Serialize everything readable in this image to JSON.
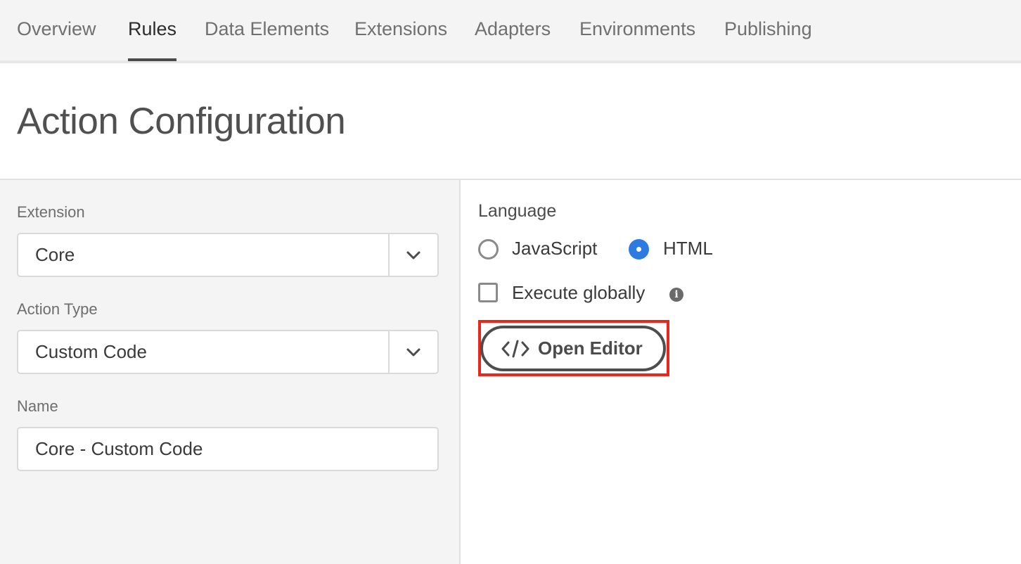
{
  "nav": {
    "tabs": [
      {
        "label": "Overview"
      },
      {
        "label": "Rules"
      },
      {
        "label": "Data Elements"
      },
      {
        "label": "Extensions"
      },
      {
        "label": "Adapters"
      },
      {
        "label": "Environments"
      },
      {
        "label": "Publishing"
      }
    ],
    "active_tab": "Rules"
  },
  "header": {
    "title": "Action Configuration"
  },
  "form": {
    "extension": {
      "label": "Extension",
      "value": "Core"
    },
    "action_type": {
      "label": "Action Type",
      "value": "Custom Code"
    },
    "name": {
      "label": "Name",
      "value": "Core - Custom Code"
    }
  },
  "settings": {
    "language_label": "Language",
    "language_options": [
      {
        "label": "JavaScript",
        "selected": false
      },
      {
        "label": "HTML",
        "selected": true
      }
    ],
    "execute_globally": {
      "label": "Execute globally",
      "checked": false
    },
    "open_editor_label": "Open Editor"
  },
  "colors": {
    "accent_blue": "#2d7be0",
    "highlight_red": "#e8271e"
  },
  "icons": [
    "chevron-down-icon",
    "info-icon",
    "code-icon"
  ]
}
